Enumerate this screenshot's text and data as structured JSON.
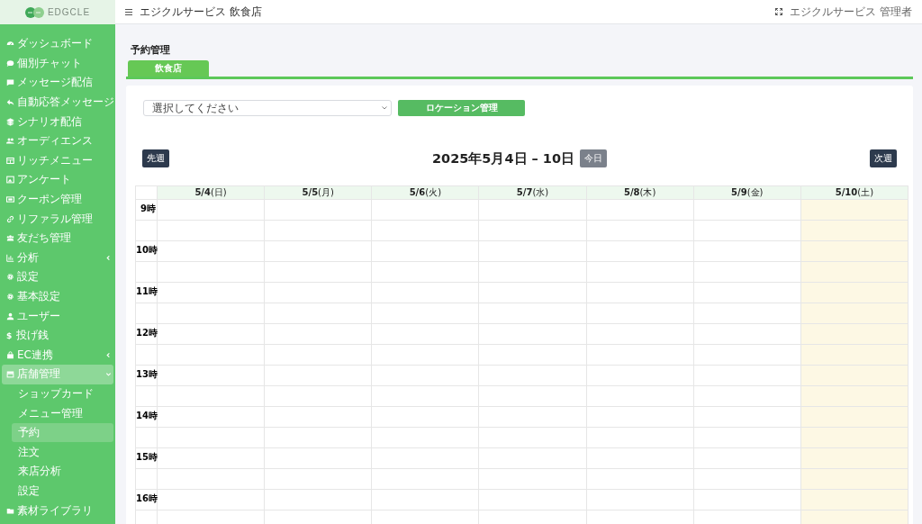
{
  "logo": {
    "text": "EDGCLE"
  },
  "topbar": {
    "title": "エジクルサービス 飲食店",
    "user": "エジクルサービス 管理者"
  },
  "sidebar": {
    "items": [
      {
        "label": "ダッシュボード",
        "selected": false
      },
      {
        "label": "個別チャット",
        "selected": false
      },
      {
        "label": "メッセージ配信",
        "selected": false
      },
      {
        "label": "自動応答メッセージ",
        "selected": false
      },
      {
        "label": "シナリオ配信",
        "selected": false
      },
      {
        "label": "オーディエンス",
        "selected": false
      },
      {
        "label": "リッチメニュー",
        "selected": false
      },
      {
        "label": "アンケート",
        "selected": false
      },
      {
        "label": "クーポン管理",
        "selected": false
      },
      {
        "label": "リファラル管理",
        "selected": false
      },
      {
        "label": "友だち管理",
        "selected": false
      },
      {
        "label": "分析",
        "selected": false,
        "expanded": false
      },
      {
        "label": "設定",
        "selected": false
      },
      {
        "label": "基本設定",
        "selected": false
      },
      {
        "label": "ユーザー",
        "selected": false
      },
      {
        "label": "投げ銭",
        "selected": false,
        "icon_text": "$"
      },
      {
        "label": "EC連携",
        "selected": false,
        "expanded": false
      },
      {
        "label": "店舗管理",
        "selected": true,
        "expanded": true,
        "children": [
          {
            "label": "ショップカード",
            "selected": false
          },
          {
            "label": "メニュー管理",
            "selected": false
          },
          {
            "label": "予約",
            "selected": true
          },
          {
            "label": "注文",
            "selected": false
          },
          {
            "label": "来店分析",
            "selected": false
          },
          {
            "label": "設定",
            "selected": false
          }
        ]
      },
      {
        "label": "素材ライブラリ",
        "selected": false
      }
    ]
  },
  "page_title": "予約管理",
  "tabs": [
    {
      "label": "飲食店",
      "selected": true
    }
  ],
  "location_select": {
    "placeholder": "選択してください"
  },
  "location_button": "ロケーション管理",
  "calendar": {
    "prev": "先週",
    "title": "2025年5月4日 – 10日",
    "today": "今日",
    "next": "次週",
    "days": [
      {
        "label": "**5/4**(日)",
        "today": false
      },
      {
        "label": "**5/5**(月)",
        "today": false
      },
      {
        "label": "**5/6**(火)",
        "today": false
      },
      {
        "label": "**5/7**(水)",
        "today": false
      },
      {
        "label": "**5/8**(木)",
        "today": false
      },
      {
        "label": "**5/9**(金)",
        "today": false
      },
      {
        "label": "**5/10**(土)",
        "today": true
      }
    ],
    "hours": [
      "9時",
      "10時",
      "11時",
      "12時",
      "13時",
      "14時",
      "15時",
      "16時"
    ]
  }
}
